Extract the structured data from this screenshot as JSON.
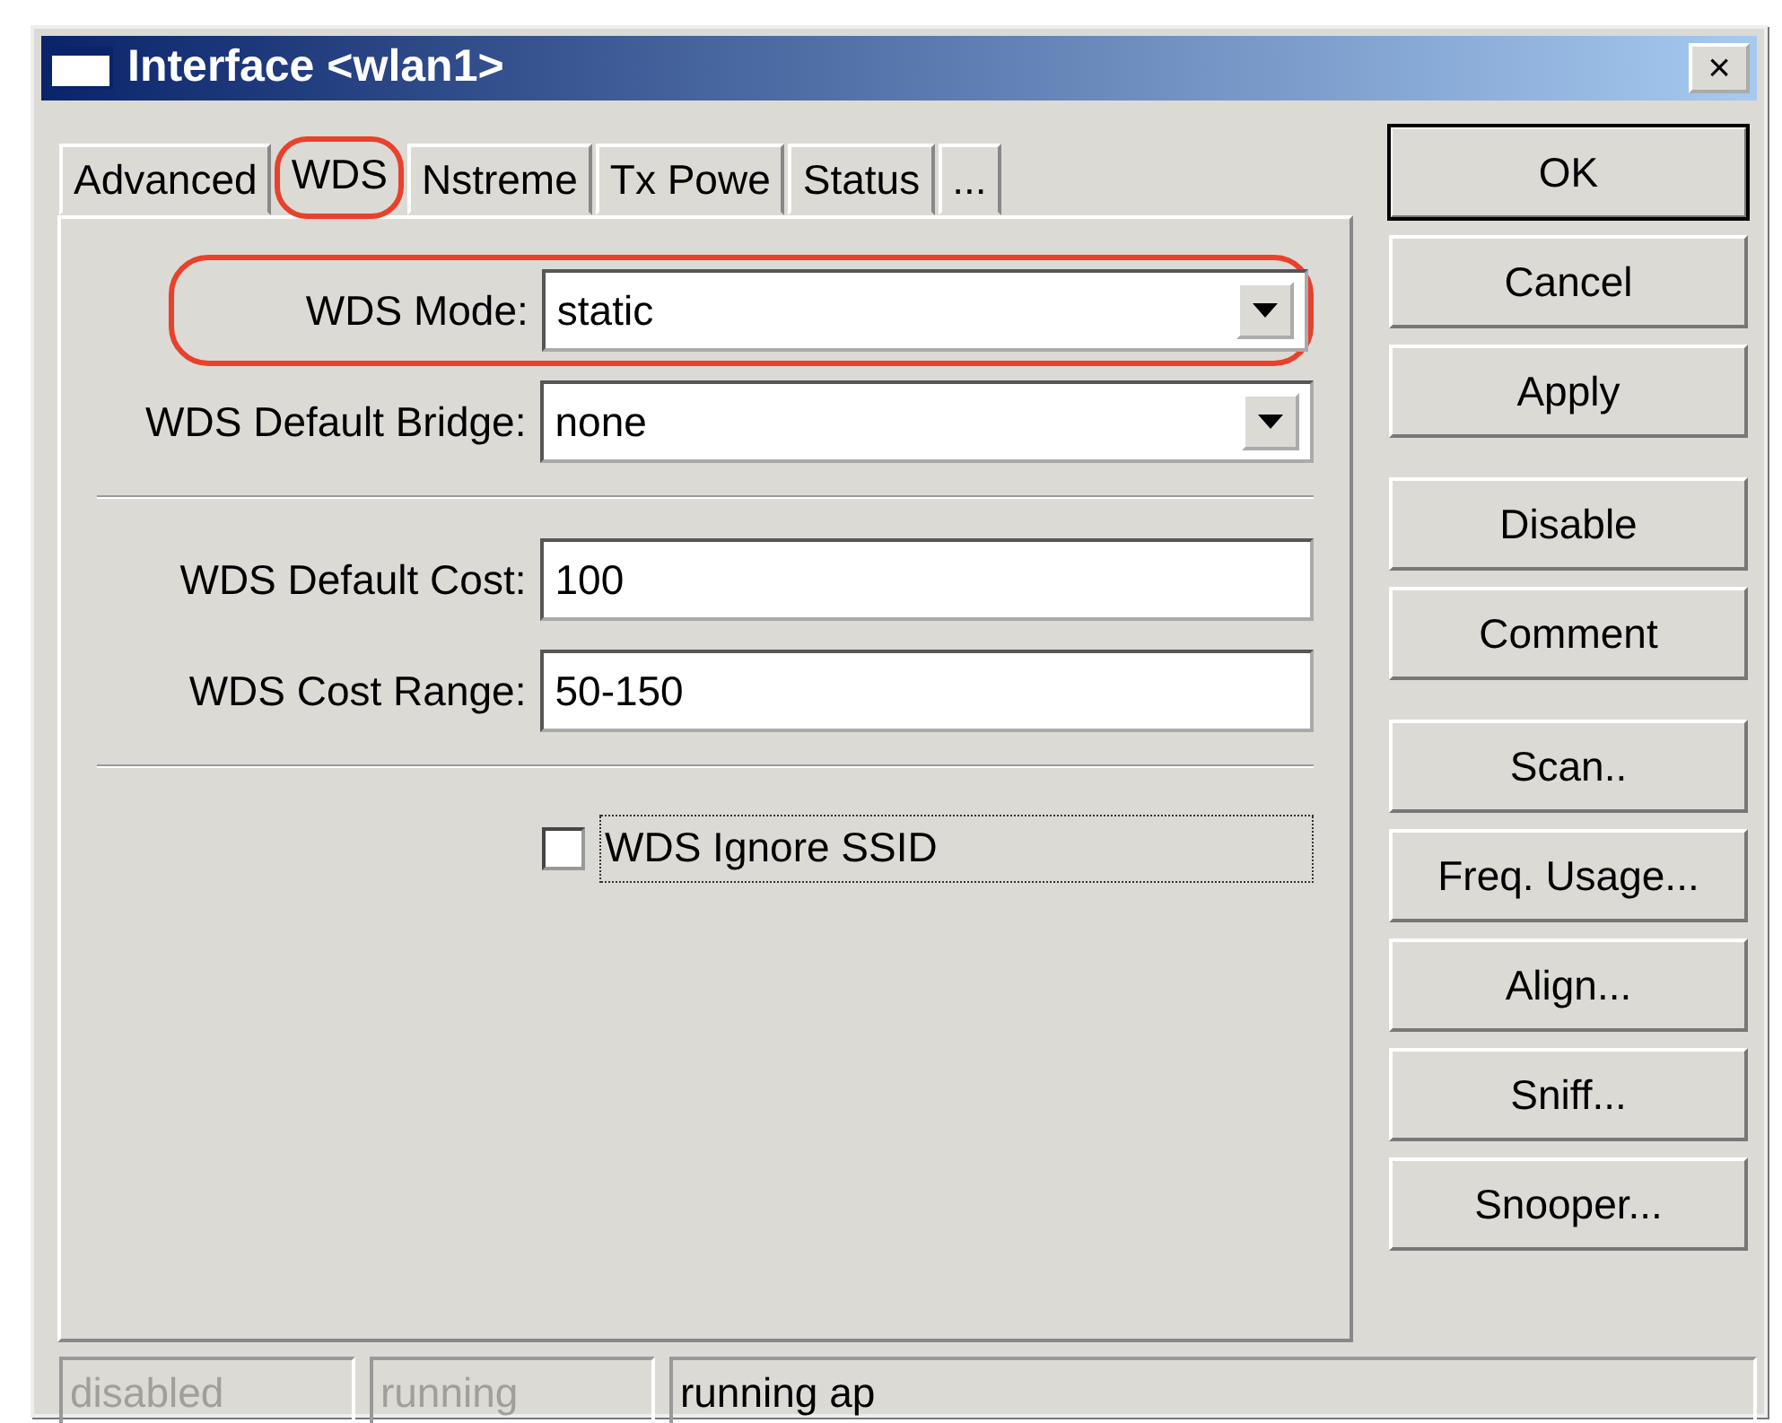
{
  "window": {
    "title": "Interface <wlan1>",
    "close": "×"
  },
  "tabs": [
    {
      "label": "Advanced",
      "selected": false,
      "highlighted": false
    },
    {
      "label": "WDS",
      "selected": true,
      "highlighted": true
    },
    {
      "label": "Nstreme",
      "selected": false,
      "highlighted": false
    },
    {
      "label": "Tx Powe",
      "selected": false,
      "highlighted": false
    },
    {
      "label": "Status",
      "selected": false,
      "highlighted": false
    },
    {
      "label": "...",
      "selected": false,
      "highlighted": false
    }
  ],
  "field_groups": [
    [
      {
        "kind": "select",
        "label": "WDS Mode:",
        "value": "static",
        "highlighted": true
      },
      {
        "kind": "select",
        "label": "WDS Default Bridge:",
        "value": "none",
        "highlighted": false
      }
    ],
    [
      {
        "kind": "text",
        "label": "WDS Default Cost:",
        "value": "100",
        "highlighted": false
      },
      {
        "kind": "text",
        "label": "WDS Cost Range:",
        "value": "50-150",
        "highlighted": false
      }
    ],
    [
      {
        "kind": "checkbox",
        "label": "WDS Ignore SSID",
        "checked": false,
        "highlighted": false
      }
    ]
  ],
  "button_groups": [
    [
      {
        "label": "OK",
        "default": true
      },
      {
        "label": "Cancel",
        "default": false
      },
      {
        "label": "Apply",
        "default": false
      }
    ],
    [
      {
        "label": "Disable",
        "default": false
      },
      {
        "label": "Comment",
        "default": false
      }
    ],
    [
      {
        "label": "Scan..",
        "default": false
      },
      {
        "label": "Freq. Usage...",
        "default": false
      },
      {
        "label": "Align...",
        "default": false
      },
      {
        "label": "Sniff...",
        "default": false
      },
      {
        "label": "Snooper...",
        "default": false
      }
    ]
  ],
  "status_bar": [
    {
      "text": "disabled",
      "active": false
    },
    {
      "text": "running",
      "active": false
    },
    {
      "text": "running ap",
      "active": true
    }
  ]
}
